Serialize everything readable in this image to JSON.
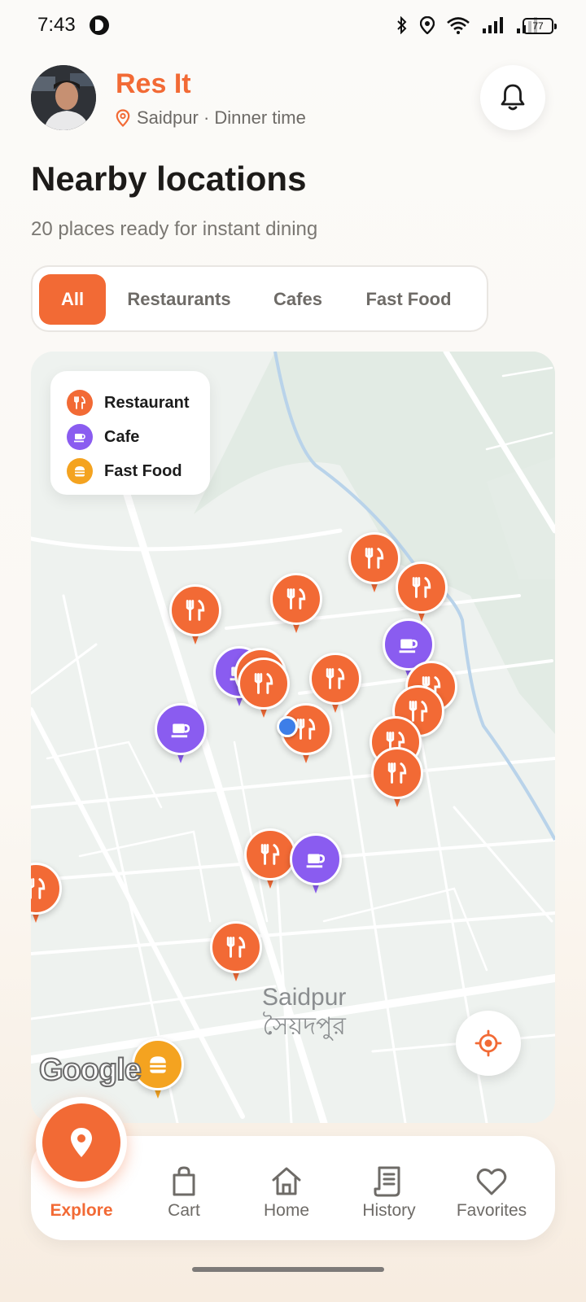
{
  "status_bar": {
    "time": "7:43",
    "battery": "77"
  },
  "header": {
    "app_title": "Res It",
    "location": "Saidpur · Dinner time"
  },
  "page_title": "Nearby locations",
  "subtitle": "20 places ready for instant dining",
  "filters": {
    "all": "All",
    "restaurants": "Restaurants",
    "cafes": "Cafes",
    "fast_food": "Fast Food",
    "active": "All"
  },
  "legend": {
    "restaurant": "Restaurant",
    "cafe": "Cafe",
    "fast_food": "Fast Food"
  },
  "map": {
    "city_name": "Saidpur",
    "city_name_bn": "সৈয়দপুর",
    "attribution": "Google"
  },
  "nav": {
    "explore": "Explore",
    "cart": "Cart",
    "home": "Home",
    "history": "History",
    "favorites": "Favorites"
  },
  "colors": {
    "accent": "#f26a35",
    "restaurant": "#f26a35",
    "cafe": "#8a5cf0",
    "fast_food": "#f4a320",
    "user": "#3d7ee8"
  },
  "icons": {
    "bell": "bell-icon",
    "location": "map-pin-icon",
    "restaurant": "fork-knife-icon",
    "cafe": "coffee-cup-icon",
    "fast_food": "burger-icon",
    "locate": "crosshair-icon",
    "cart": "shopping-bag-icon",
    "home": "house-icon",
    "history": "receipt-icon",
    "favorites": "heart-icon"
  }
}
